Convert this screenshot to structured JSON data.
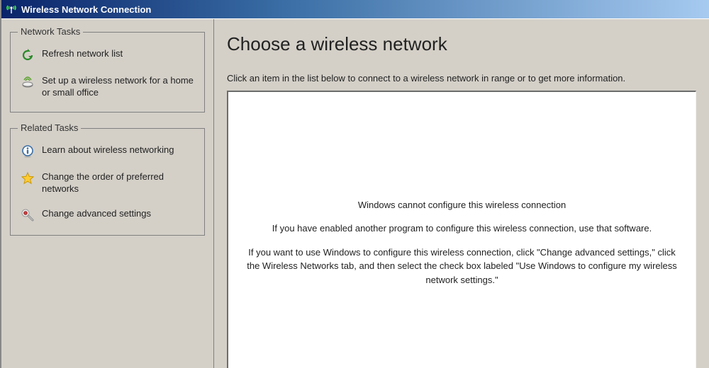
{
  "window": {
    "title": "Wireless Network Connection"
  },
  "sidebar": {
    "networkTasks": {
      "legend": "Network Tasks",
      "items": [
        {
          "label": "Refresh network list"
        },
        {
          "label": "Set up a wireless network for a home or small office"
        }
      ]
    },
    "relatedTasks": {
      "legend": "Related Tasks",
      "items": [
        {
          "label": "Learn about wireless networking"
        },
        {
          "label": "Change the order of preferred networks"
        },
        {
          "label": "Change advanced settings"
        }
      ]
    }
  },
  "main": {
    "heading": "Choose a wireless network",
    "instruction": "Click an item in the list below to connect to a wireless network in range or to get more information.",
    "message": {
      "line1": "Windows cannot configure this wireless connection",
      "line2": "If you have enabled another program to configure this wireless connection, use that software.",
      "line3": "If you want to use Windows to configure this wireless connection, click \"Change advanced settings,\" click the Wireless Networks tab, and then select the check box labeled \"Use Windows to configure my wireless network settings.\""
    }
  }
}
